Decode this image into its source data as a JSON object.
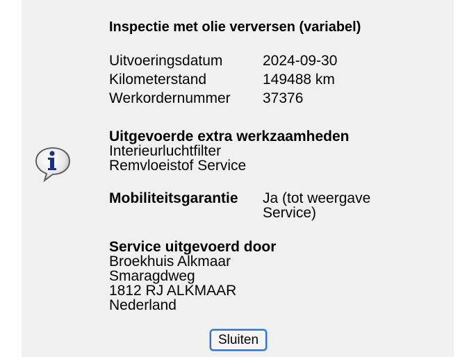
{
  "dialog": {
    "title": "Inspectie met olie verversen (variabel)",
    "details": [
      {
        "label": "Uitvoeringsdatum",
        "value": "2024-09-30"
      },
      {
        "label": "Kilometerstand",
        "value": "149488 km"
      },
      {
        "label": "Werkordernummer",
        "value": "37376"
      }
    ],
    "extra_work": {
      "heading": "Uitgevoerde extra werkzaamheden",
      "items": [
        "Interieurluchtfilter",
        "Remvloeistof Service"
      ]
    },
    "mobility": {
      "label": "Mobiliteitsgarantie",
      "value": "Ja (tot weergave Service)"
    },
    "serviced_by": {
      "heading": "Service uitgevoerd door",
      "lines": [
        "Broekhuis Alkmaar",
        "Smaragdweg",
        "1812 RJ ALKMAAR",
        "Nederland"
      ]
    },
    "close_label": "Sluiten"
  },
  "icons": {
    "info": "info-speech-bubble-icon"
  }
}
